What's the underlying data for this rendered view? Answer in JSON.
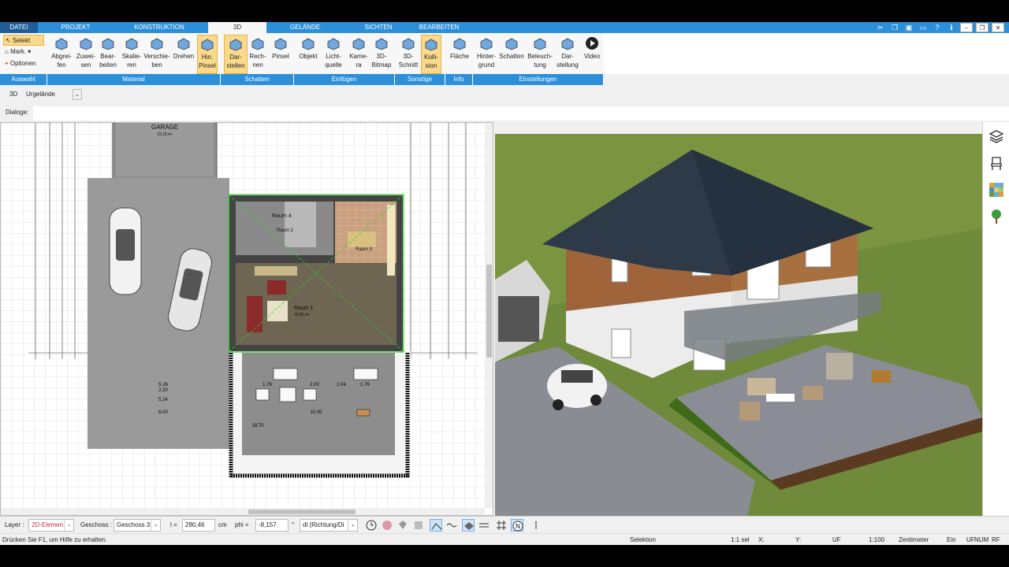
{
  "tabs": [
    {
      "label": "DATEI"
    },
    {
      "label": "PROJEKT"
    },
    {
      "label": "KONSTRUKTION"
    },
    {
      "label": "3D"
    },
    {
      "label": "GELÄNDE"
    },
    {
      "label": "SICHTEN"
    },
    {
      "label": "BEARBEITEN"
    }
  ],
  "auswahl": {
    "selekt": "Selekt",
    "mark": "Mark.",
    "optionen": "Optionen"
  },
  "ribbon_buttons": [
    {
      "label": "Abgrei-\nfen"
    },
    {
      "label": "Zuwei-\nsen"
    },
    {
      "label": "Bear-\nbeiten"
    },
    {
      "label": "Skalie-\nren"
    },
    {
      "label": "Verschie-\nben"
    },
    {
      "label": "Drehen"
    },
    {
      "label": "Hin.\nPinsel"
    },
    {
      "label": "Dar-\nstellen"
    },
    {
      "label": "Rech-\nnen"
    },
    {
      "label": "Pinsel"
    },
    {
      "label": "Objekt"
    },
    {
      "label": "Licht-\nquelle"
    },
    {
      "label": "Kame-\nra"
    },
    {
      "label": "3D-\nBitmap"
    },
    {
      "label": "3D-\nSchnitt"
    },
    {
      "label": "Kolli-\nsion"
    },
    {
      "label": "Fläche"
    },
    {
      "label": "Hinter-\ngrund"
    },
    {
      "label": "Schatten"
    },
    {
      "label": "Beleuch-\ntung"
    },
    {
      "label": "Dar-\nstellung"
    },
    {
      "label": "Video"
    }
  ],
  "groups": [
    {
      "label": "Auswahl"
    },
    {
      "label": "Material"
    },
    {
      "label": "Schatten"
    },
    {
      "label": "Einfügen"
    },
    {
      "label": "Sonstige"
    },
    {
      "label": "Info"
    },
    {
      "label": "Einstellungen"
    }
  ],
  "row3d": {
    "label": "3D",
    "value": "Urgelände"
  },
  "dialoge": {
    "label": "Dialoge:"
  },
  "plan": {
    "garage_label": "GARAGE",
    "garage_area": "33,18 m²",
    "room1": "Raum 1",
    "room1_area": "35,82 m²",
    "room2": "Raum 2",
    "room3": "Raum 3",
    "room4": "Raum 4",
    "dims": [
      "5.26",
      "2.20",
      "5.24",
      "6.00",
      "1.76",
      "2.00",
      "1.04",
      "1.76",
      "10.00",
      "18.70"
    ]
  },
  "bottom": {
    "layer_label": "Layer :",
    "layer_value": "2D-Elemen",
    "geschoss_label": "Geschoss :",
    "geschoss_value": "Geschoss 3",
    "l_label": "l =",
    "l_value": "280,46",
    "l_unit": "cm",
    "phi_label": "phi =",
    "phi_value": "-8,157",
    "phi_unit": "°",
    "dl_value": "dl (Richtung/Di"
  },
  "status": {
    "hint": "Drücken Sie F1, um Hilfe zu erhalten.",
    "mode": "Selektion",
    "sel": "1:1 sel",
    "x": "X:",
    "y": "Y:",
    "uf": "UF",
    "scale": "1:100",
    "unit": "Zentimeter",
    "ein": "Ein",
    "uf2": "UF",
    "num": "NUM",
    "rf": "RF"
  }
}
